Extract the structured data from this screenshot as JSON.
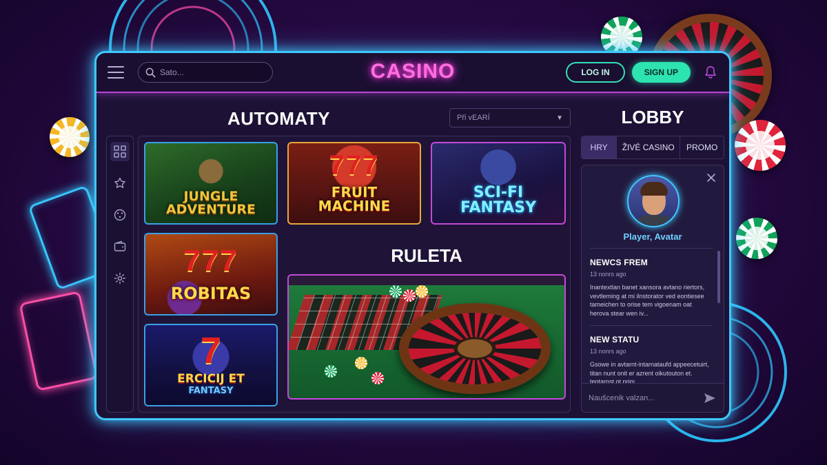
{
  "header": {
    "brand": "CASINO",
    "search_placeholder": "Sato...",
    "login_label": "LOG IN",
    "signup_label": "SIGN UP"
  },
  "icons": {
    "menu": "hamburger-icon",
    "search": "search-icon",
    "bell": "bell-icon",
    "rail": [
      "grid-icon",
      "star-icon",
      "dice-icon",
      "wallet-icon",
      "gear-icon"
    ],
    "close": "close-icon",
    "send": "send-icon"
  },
  "colors": {
    "frame_neon": "#3fc8ff",
    "brand_pink": "#ff6fe0",
    "accent_green": "#2de3b0",
    "divider_purple": "#b646d8"
  },
  "games": {
    "title": "AUTOMATY",
    "sort_selected": "Při vEARÍ",
    "tiles": [
      {
        "title_line1": "JUNGLE",
        "title_line2": "ADVENTURE"
      },
      {
        "sevens": "777",
        "title_line1": "FRUIT",
        "title_line2": "MACHINE"
      },
      {
        "title_line1": "SCI-FI",
        "title_line2": "FANTASY"
      },
      {
        "sevens": "777",
        "title_line1": "ROBITAS"
      },
      {
        "sevens": "7",
        "title_line1": "ERCICIJ ET",
        "title_line2": "FANTASY"
      }
    ],
    "roulette_title": "RULETA"
  },
  "lobby": {
    "title": "LOBBY",
    "tabs": [
      "HRY",
      "ŽIVÉ CASINO",
      "PROMO"
    ],
    "player_name": "Player, Avatar",
    "news": [
      {
        "title": "NEWCS FREM",
        "time": "13 nonrs ago",
        "body": "Inantextlan banet xansora avtano riertors, vevtleming at mi ilnstorator ved eontiesee tameichen to orise tem vigoenam oat herova stear wen iv..."
      },
      {
        "title": "NEW STATU",
        "time": "13 nonrs ago",
        "body": "Gsowe in avtarnt-intarnataufd appeecetuirt, titan nunt onit er azrent oikutouton et. tentarnst ot prim..."
      }
    ],
    "message_placeholder": "Naušcenik valzan..."
  }
}
